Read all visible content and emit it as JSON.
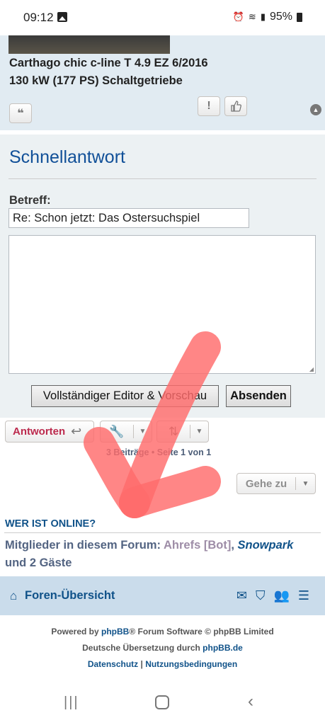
{
  "status_bar": {
    "time": "09:12",
    "battery": "95%"
  },
  "post": {
    "line1": "Carthago chic c-line T 4.9 EZ 6/2016",
    "line2": "130 kW (177 PS) Schaltgetriebe"
  },
  "quick_reply": {
    "title": "Schnellantwort",
    "subject_label": "Betreff:",
    "subject_value": "Re: Schon jetzt: Das Ostersuchspiel",
    "full_editor_label": "Vollständiger Editor & Vorschau",
    "submit_label": "Absenden"
  },
  "actions": {
    "reply_label": "Antworten",
    "pagination": "3 Beiträge • Seite 1 von 1",
    "jump_label": "Gehe zu"
  },
  "online": {
    "heading": "WER IST ONLINE?",
    "prefix": "Mitglieder in diesem Forum: ",
    "bot": "Ahrefs [Bot]",
    "comma": ", ",
    "user": "Snowpark",
    "suffix": " und 2 Gäste"
  },
  "nav": {
    "home_label": "Foren-Übersicht"
  },
  "footer": {
    "powered_prefix": "Powered by ",
    "phpbb": "phpBB",
    "powered_suffix": "® Forum Software © phpBB Limited",
    "translation_prefix": "Deutsche Übersetzung durch ",
    "translation_link": "phpBB.de",
    "privacy": "Datenschutz",
    "sep": " | ",
    "terms": "Nutzungsbedingungen"
  },
  "colors": {
    "annotation": "#ff6b6b",
    "brand": "#105289",
    "reply": "#bc2a4d"
  }
}
